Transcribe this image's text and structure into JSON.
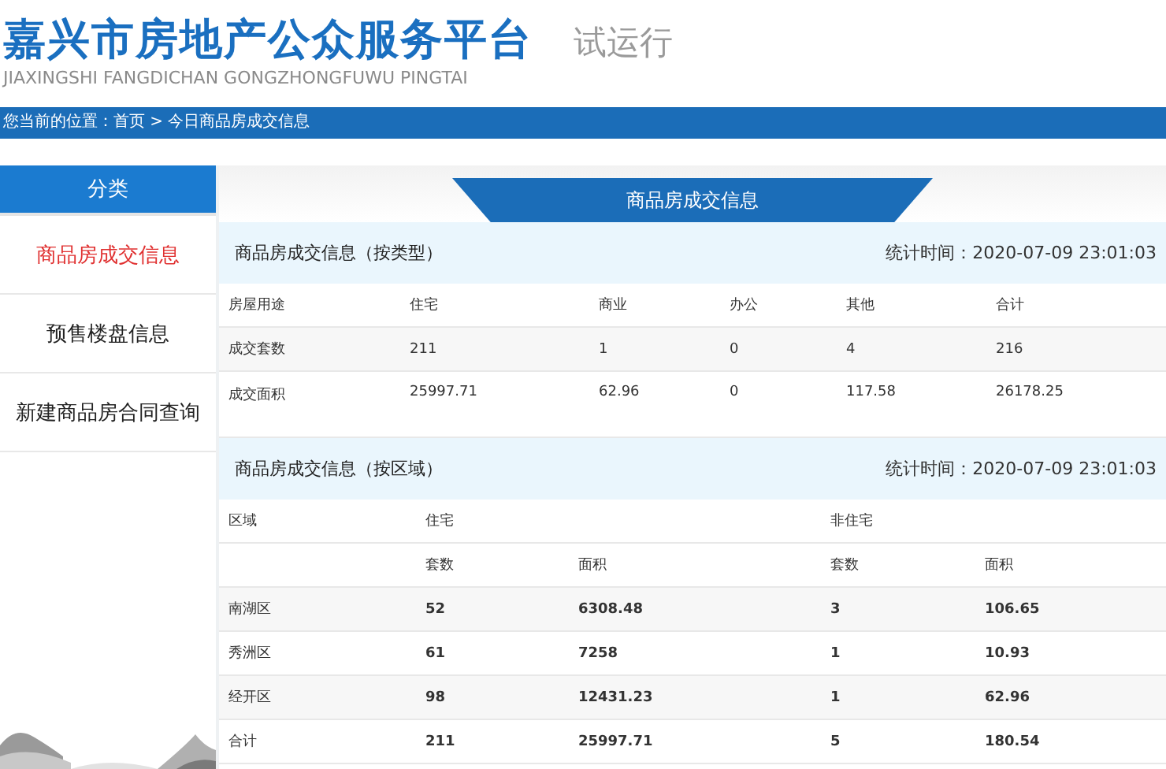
{
  "header": {
    "title": "嘉兴市房地产公众服务平台",
    "subtitle": "JIAXINGSHI FANGDICHAN GONGZHONGFUWU PINGTAI",
    "badge": "试运行"
  },
  "breadcrumb": "您当前的位置：首页 > 今日商品房成交信息",
  "sidebar": {
    "title": "分类",
    "items": [
      {
        "label": "商品房成交信息",
        "selected": true
      },
      {
        "label": "预售楼盘信息",
        "selected": false
      },
      {
        "label": "新建商品房合同查询",
        "selected": false
      }
    ]
  },
  "tab": "商品房成交信息",
  "by_type": {
    "title": "商品房成交信息（按类型）",
    "time": "统计时间：2020-07-09 23:01:03",
    "rows": [
      [
        "房屋用途",
        "住宅",
        "商业",
        "办公",
        "其他",
        "合计"
      ],
      [
        "成交套数",
        "211",
        "1",
        "0",
        "4",
        "216"
      ],
      [
        "成交面积",
        "25997.71",
        "62.96",
        "0",
        "117.58",
        "26178.25"
      ]
    ]
  },
  "by_area": {
    "title": "商品房成交信息（按区域）",
    "time": "统计时间：2020-07-09 23:01:03",
    "head1": [
      "区域",
      "住宅",
      "非住宅"
    ],
    "head2": [
      "套数",
      "面积",
      "套数",
      "面积"
    ],
    "rows": [
      [
        "南湖区",
        "52",
        "6308.48",
        "3",
        "106.65"
      ],
      [
        "秀洲区",
        "61",
        "7258",
        "1",
        "10.93"
      ],
      [
        "经开区",
        "98",
        "12431.23",
        "1",
        "62.96"
      ],
      [
        "合计",
        "211",
        "25997.71",
        "5",
        "180.54"
      ]
    ]
  }
}
